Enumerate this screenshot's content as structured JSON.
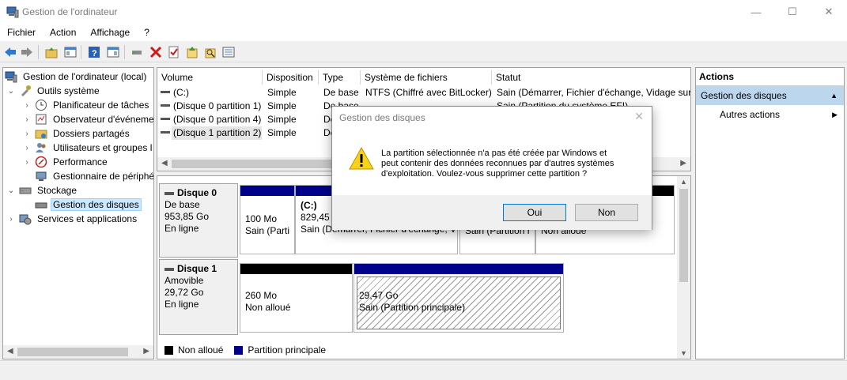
{
  "window": {
    "title": "Gestion de l'ordinateur",
    "min_glyph": "—",
    "max_glyph": "☐",
    "close_glyph": "✕"
  },
  "menu": [
    "Fichier",
    "Action",
    "Affichage",
    "?"
  ],
  "toolbar_icons": [
    "back-icon",
    "forward-icon",
    "up-folder-icon",
    "console-tree-icon",
    "help-icon",
    "properties-icon",
    "connect-icon",
    "delete-icon",
    "check-icon",
    "export-icon",
    "search-icon",
    "list-icon"
  ],
  "tree": {
    "root": "Gestion de l'ordinateur (local)",
    "items": [
      {
        "label": "Outils système",
        "level": 1,
        "expander": "⌄"
      },
      {
        "label": "Planificateur de tâches",
        "level": 2,
        "expander": "›"
      },
      {
        "label": "Observateur d'événeme",
        "level": 2,
        "expander": "›"
      },
      {
        "label": "Dossiers partagés",
        "level": 2,
        "expander": "›"
      },
      {
        "label": "Utilisateurs et groupes l",
        "level": 2,
        "expander": "›"
      },
      {
        "label": "Performance",
        "level": 2,
        "expander": "›"
      },
      {
        "label": "Gestionnaire de périphé",
        "level": 2,
        "expander": ""
      },
      {
        "label": "Stockage",
        "level": 1,
        "expander": "⌄"
      },
      {
        "label": "Gestion des disques",
        "level": 2,
        "expander": "",
        "selected": true
      },
      {
        "label": "Services et applications",
        "level": 1,
        "expander": "›"
      }
    ]
  },
  "volume_list": {
    "columns": [
      "Volume",
      "Disposition",
      "Type",
      "Système de fichiers",
      "Statut"
    ],
    "rows": [
      [
        "(C:)",
        "Simple",
        "De base",
        "NTFS (Chiffré avec BitLocker)",
        "Sain (Démarrer, Fichier d'échange, Vidage sur i"
      ],
      [
        "(Disque 0 partition 1)",
        "Simple",
        "De base",
        "",
        "Sain (Partition du système EFI)"
      ],
      [
        "(Disque 0 partition 4)",
        "Simple",
        "De",
        "",
        ""
      ],
      [
        "(Disque 1 partition 2)",
        "Simple",
        "De",
        "",
        ""
      ]
    ]
  },
  "disks": [
    {
      "name": "Disque 0",
      "type": "De base",
      "size": "953,85 Go",
      "status": "En ligne",
      "partitions": [
        {
          "line1": "100 Mo",
          "line2": "Sain (Parti",
          "bar": "#00008b"
        },
        {
          "title": "(C:)",
          "line1": "829,45 G",
          "line2": "Sain (Démarrer, Fichier d'échange, V",
          "bar": "#00008b"
        },
        {
          "line1": "",
          "line2": "Sain (Partition r",
          "bar": "#00008b"
        },
        {
          "line1": "",
          "line2": "Non alloué",
          "bar": "#000000"
        }
      ]
    },
    {
      "name": "Disque 1",
      "type": "Amovible",
      "size": "29,72 Go",
      "status": "En ligne",
      "partitions": [
        {
          "line1": "260 Mo",
          "line2": "Non alloué",
          "bar": "#000000"
        },
        {
          "line1": "29,47 Go",
          "line2": "Sain (Partition principale)",
          "bar": "#00008b",
          "hatched": true
        }
      ]
    }
  ],
  "legend": [
    {
      "label": "Non alloué",
      "color": "#000000"
    },
    {
      "label": "Partition principale",
      "color": "#00008b"
    }
  ],
  "actions": {
    "title": "Actions",
    "section": "Gestion des disques",
    "item": "Autres actions"
  },
  "dialog": {
    "title": "Gestion des disques",
    "message_lines": [
      "La partition sélectionnée n'a pas été créée par Windows et",
      "peut contenir des données reconnues par d'autres systèmes",
      "d'exploitation. Voulez-vous supprimer cette partition ?"
    ],
    "yes": "Oui",
    "no": "Non"
  }
}
